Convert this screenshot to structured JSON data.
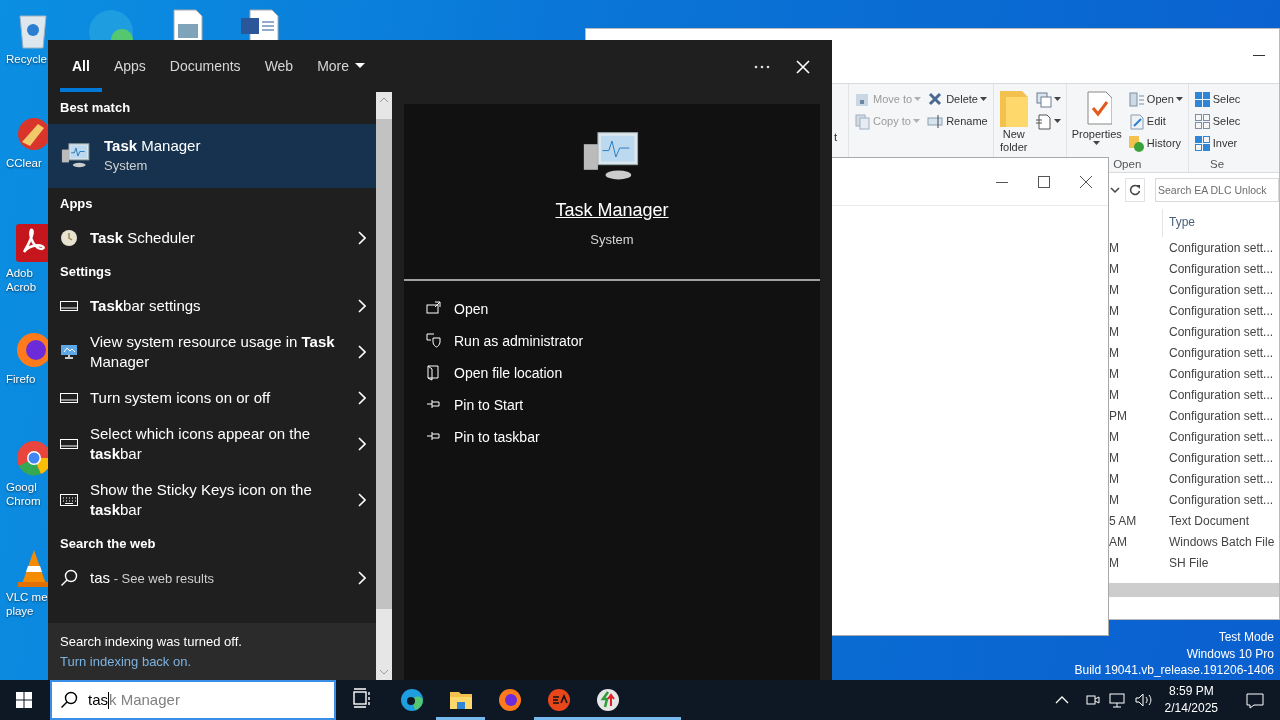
{
  "desktop_icons": [
    {
      "label": "Recycle"
    },
    {
      "label": "CClear"
    },
    {
      "label": "Adob\nAcrob"
    },
    {
      "label": "Firefo"
    },
    {
      "label": "Googl\nChrom"
    },
    {
      "label": "VLC me\nplaye"
    }
  ],
  "explorer": {
    "ribbon": {
      "cut_label": "t",
      "groups": [
        {
          "columns": [
            [
              {
                "label": "Move to",
                "kind": "small",
                "disabled": true,
                "dropdown": true
              },
              {
                "label": "Copy to",
                "kind": "small",
                "disabled": true,
                "dropdown": true
              }
            ],
            [
              {
                "label": "Delete",
                "kind": "small",
                "disabled": false,
                "dropdown": true
              },
              {
                "label": "Rename",
                "kind": "small",
                "disabled": false,
                "dropdown": false
              }
            ]
          ]
        },
        {
          "columns": [
            [
              {
                "label": "New\nfolder",
                "kind": "large",
                "disabled": false,
                "dropdown": false
              }
            ],
            [
              {
                "kind": "icon",
                "disabled": false,
                "dropdown": true
              },
              {
                "kind": "icon",
                "disabled": false,
                "dropdown": true
              }
            ]
          ]
        },
        {
          "label": "Open",
          "columns": [
            [
              {
                "label": "Properties",
                "kind": "large",
                "disabled": false,
                "dropdown": true
              }
            ],
            [
              {
                "label": "Open",
                "kind": "small",
                "disabled": false,
                "dropdown": true
              },
              {
                "label": "Edit",
                "kind": "small",
                "disabled": false,
                "dropdown": false
              },
              {
                "label": "History",
                "kind": "small",
                "disabled": false,
                "dropdown": false
              }
            ]
          ]
        },
        {
          "label": "Se",
          "columns": [
            [
              {
                "label": "Selec",
                "kind": "small",
                "disabled": false,
                "dropdown": false
              },
              {
                "label": "Selec",
                "kind": "small",
                "disabled": false,
                "dropdown": false
              },
              {
                "label": "Inver",
                "kind": "small",
                "disabled": false,
                "dropdown": false
              }
            ]
          ]
        }
      ]
    },
    "search": {
      "placeholder": "Search EA DLC Unlock"
    },
    "columns": [
      "Type"
    ],
    "rows": [
      {
        "column_1": "M",
        "type": "Configuration sett..."
      },
      {
        "column_1": "M",
        "type": "Configuration sett..."
      },
      {
        "column_1": "M",
        "type": "Configuration sett..."
      },
      {
        "column_1": "M",
        "type": "Configuration sett..."
      },
      {
        "column_1": "M",
        "type": "Configuration sett..."
      },
      {
        "column_1": "M",
        "type": "Configuration sett..."
      },
      {
        "column_1": "M",
        "type": "Configuration sett..."
      },
      {
        "column_1": "M",
        "type": "Configuration sett..."
      },
      {
        "column_1": "PM",
        "type": "Configuration sett..."
      },
      {
        "column_1": "M",
        "type": "Configuration sett..."
      },
      {
        "column_1": "M",
        "type": "Configuration sett..."
      },
      {
        "column_1": "M",
        "type": "Configuration sett..."
      },
      {
        "column_1": "M",
        "type": "Configuration sett..."
      },
      {
        "column_1": "5 AM",
        "type": "Text Document"
      },
      {
        "column_1": "AM",
        "type": "Windows Batch File"
      },
      {
        "column_1": "M",
        "type": "SH File"
      }
    ]
  },
  "search_panel": {
    "tabs": [
      {
        "label": "All",
        "selected": true,
        "kind": "tab"
      },
      {
        "label": "Apps",
        "selected": false,
        "kind": "tab"
      },
      {
        "label": "Documents",
        "selected": false,
        "kind": "tab"
      },
      {
        "label": "Web",
        "selected": false,
        "kind": "tab"
      },
      {
        "label": "More",
        "selected": false,
        "kind": "dropdown"
      }
    ],
    "sections": [
      {
        "heading": "Best match",
        "items": [
          {
            "kind": "best",
            "title": "**Task** Manager",
            "subtitle": "System",
            "selected": true
          }
        ]
      },
      {
        "heading": "Apps",
        "items": [
          {
            "kind": "result",
            "title": "**Task** Scheduler",
            "selected": false
          }
        ]
      },
      {
        "heading": "Settings",
        "items": [
          {
            "kind": "result",
            "title": "**Task**bar settings",
            "selected": false
          },
          {
            "kind": "result",
            "title": "View system resource usage in **Task** Manager",
            "selected": false
          },
          {
            "kind": "result",
            "title": "Turn system icons on or off",
            "selected": false
          },
          {
            "kind": "result",
            "title": "Select which icons appear on the **task**bar",
            "selected": false
          },
          {
            "kind": "result",
            "title": "Show the Sticky Keys icon on the **task**bar",
            "selected": false
          }
        ]
      },
      {
        "heading": "Search the web",
        "items": [
          {
            "kind": "web",
            "title": "tas",
            "subtitle": " - See web results",
            "selected": false
          }
        ]
      }
    ],
    "notice": "Search indexing was turned off.",
    "notice_link": "Turn indexing back on.",
    "preview": {
      "title": "Task Manager",
      "subtitle": "System",
      "actions": [
        {
          "label": "Open"
        },
        {
          "label": "Run as administrator"
        },
        {
          "label": "Open file location"
        },
        {
          "label": "Pin to Start"
        },
        {
          "label": "Pin to taskbar"
        }
      ]
    }
  },
  "desktop_info": [
    "Test Mode",
    "Windows 10 Pro",
    "Build 19041.vb_release.191206-1406"
  ],
  "taskbar": {
    "search": {
      "value": "tas",
      "suggestion": "k Manager"
    },
    "apps": [
      {
        "running": false
      },
      {
        "running": false
      },
      {
        "running": true
      },
      {
        "running": false
      },
      {
        "running": true
      },
      {
        "running": true
      },
      {
        "running": true
      }
    ],
    "clock": {
      "time": "8:59 PM",
      "date": "2/14/2025"
    }
  }
}
